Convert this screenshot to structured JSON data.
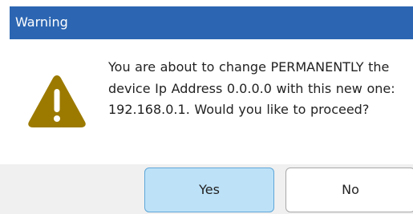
{
  "dialog": {
    "title": "Warning",
    "message": "You are about to change PERMANENTLY the device Ip Address 0.0.0.0 with this new one: 192.168.0.1. Would you like to proceed?",
    "icon": "warning-triangle-icon"
  },
  "buttons": {
    "yes_label": "Yes",
    "no_label": "No"
  },
  "colors": {
    "titlebar": "#2c66b2",
    "warning_icon": "#9c7a00",
    "yes_button_bg": "#bde2f8",
    "yes_button_border": "#5fa6d8",
    "footer_bg": "#f0f0f0"
  }
}
